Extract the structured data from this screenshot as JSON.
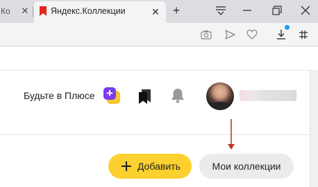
{
  "browser": {
    "tabs": [
      {
        "label": "Ко",
        "active": false
      },
      {
        "label": "Яндекс.Коллекции",
        "active": true
      }
    ],
    "accent_color": "#1b9cf2"
  },
  "toolbar_icons": [
    "camera-icon",
    "send-icon",
    "heart-icon",
    "download-icon",
    "extensions-icon"
  ],
  "header": {
    "plus_promo": "Будьте в Плюсе",
    "plus_badge_colors": [
      "#7b3cf0",
      "#f7c52e"
    ]
  },
  "actions": {
    "add_label": "Добавить",
    "add_color": "#fcd02f",
    "my_collections_label": "Мои коллекции"
  },
  "annotation_color": "#c0352b"
}
